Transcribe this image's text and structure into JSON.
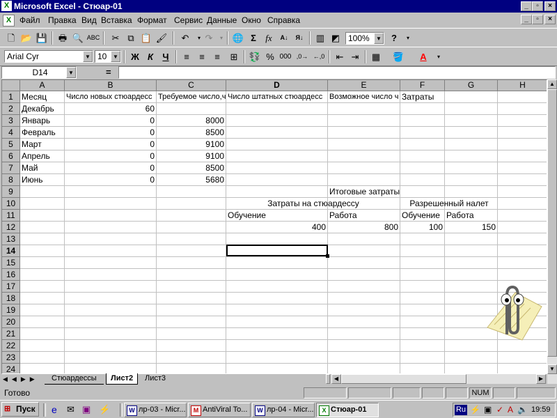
{
  "window": {
    "title": "Microsoft Excel - Стюар-01",
    "minimize": "_",
    "maximize": "▫",
    "close": "×"
  },
  "menu": [
    "Файл",
    "Правка",
    "Вид",
    "Вставка",
    "Формат",
    "Сервис",
    "Данные",
    "Окно",
    "Справка"
  ],
  "toolbar": {
    "zoom": "100%"
  },
  "format_toolbar": {
    "font": "Arial Cyr",
    "size": "10",
    "bold": "Ж",
    "italic": "К",
    "underline": "Ч",
    "percent": "%",
    "thousands": "000"
  },
  "formula_bar": {
    "name_box": "D14",
    "equals": "="
  },
  "columns": [
    "A",
    "B",
    "C",
    "D",
    "E",
    "F",
    "G",
    "H"
  ],
  "rows": [
    "1",
    "2",
    "3",
    "4",
    "5",
    "6",
    "7",
    "8",
    "9",
    "10",
    "11",
    "12",
    "13",
    "14",
    "15",
    "16",
    "17",
    "18",
    "19",
    "20",
    "21",
    "22",
    "23",
    "24"
  ],
  "cells": {
    "A1": "Месяц",
    "B1": "Число новых стюардесс",
    "C1": "Требуемое число,ч",
    "D1": "Число штатных стюардесс",
    "E1": "Возможное число ч",
    "F1": "Затраты",
    "A2": "Декабрь",
    "B2": "60",
    "A3": "Январь",
    "B3": "0",
    "C3": "8000",
    "A4": "Февраль",
    "B4": "0",
    "C4": "8500",
    "A5": "Март",
    "B5": "0",
    "C5": "9100",
    "A6": "Апрель",
    "B6": "0",
    "C6": "9100",
    "A7": "Май",
    "B7": "0",
    "C7": "8500",
    "A8": "Июнь",
    "B8": "0",
    "C8": "5680",
    "E9": "Итоговые затраты",
    "D10": "Затраты на стюардессу",
    "F10": "Разрешенный налет",
    "D11": "Обучение",
    "E11": "Работа",
    "F11": "Обучение",
    "G11": "Работа",
    "D12": "400",
    "E12": "800",
    "F12": "100",
    "G12": "150"
  },
  "sheets": [
    "Стюардессы",
    "Лист2",
    "Лист3"
  ],
  "active_sheet": "Лист2",
  "status": {
    "ready": "Готово",
    "num": "NUM"
  },
  "taskbar": {
    "start": "Пуск",
    "tasks": [
      "лр-03 - Micr...",
      "AntiViral To...",
      "лр-04 - Micr...",
      "Стюар-01"
    ],
    "lang": "Ru",
    "time": "19:59"
  },
  "colors": {
    "title_bar": "#000080",
    "selection_border": "#000000"
  }
}
